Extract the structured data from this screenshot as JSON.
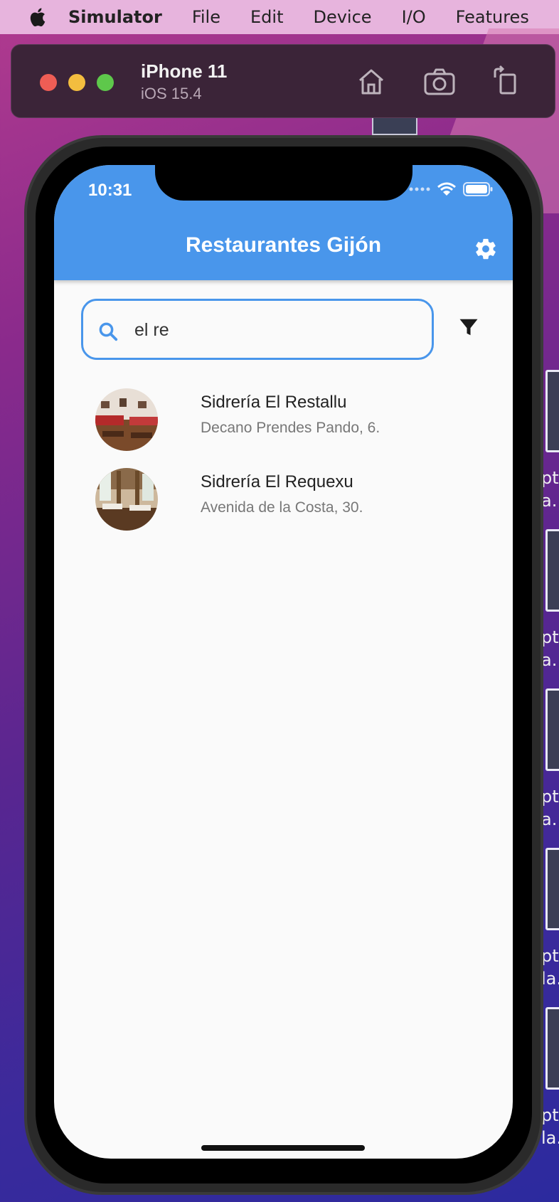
{
  "menubar": {
    "app": "Simulator",
    "items": [
      "File",
      "Edit",
      "Device",
      "I/O",
      "Features"
    ]
  },
  "simulator": {
    "device": "iPhone 11",
    "os": "iOS 15.4"
  },
  "status": {
    "time": "10:31"
  },
  "appbar": {
    "title": "Restaurantes Gijón",
    "settings_icon": "gear-icon"
  },
  "search": {
    "value": "el re",
    "icon": "search-icon"
  },
  "filter": {
    "icon": "filter-icon"
  },
  "results": [
    {
      "name": "Sidrería El Restallu",
      "address": "Decano Prendes Pando, 6."
    },
    {
      "name": "Sidrería El Requexu",
      "address": "Avenida de la Costa, 30."
    }
  ],
  "desktop": {
    "labels": [
      "pt",
      "a.",
      "pt",
      "a.",
      "pt",
      "a.",
      "pt",
      "la.",
      "pt",
      "la."
    ]
  },
  "colors": {
    "accent": "#4996eb",
    "menubar": "#e7b4dd"
  }
}
